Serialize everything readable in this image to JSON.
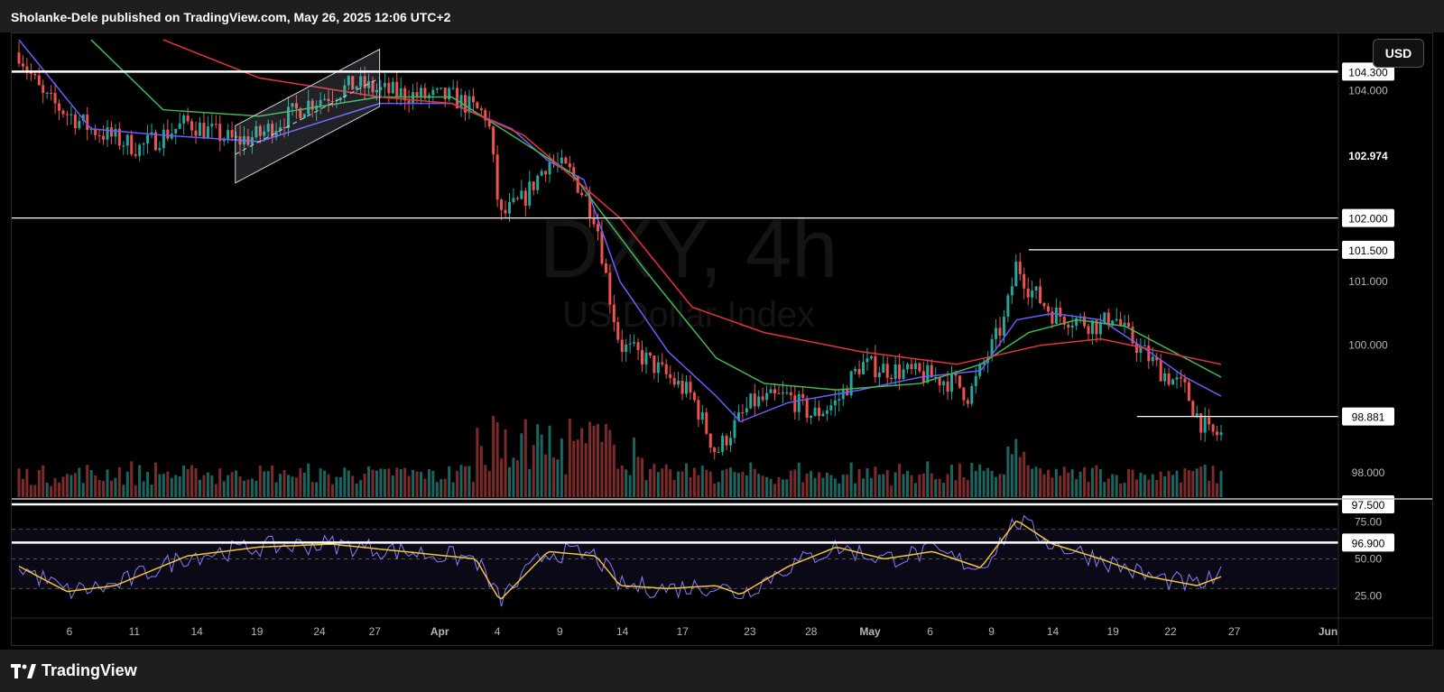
{
  "header": {
    "publisher_line": "Sholanke-Dele published on TradingView.com, May 26, 2025 12:06 UTC+2"
  },
  "toolbar": {
    "currency_label": "USD"
  },
  "footer": {
    "brand": "TradingView"
  },
  "watermark": {
    "symbol": "DXY, 4h",
    "name": "US Dollar Index"
  },
  "colors": {
    "background": "#000000",
    "bull": "#26a69a",
    "bear": "#ef5350",
    "ma_fast": "#6a5cff",
    "ma_mid": "#3fb950",
    "ma_slow": "#e8333b",
    "rsi": "#8c7bff",
    "rsi_ma": "#f2c530"
  },
  "chart_data": {
    "type": "candlestick",
    "symbol": "DXY",
    "timeframe": "4h",
    "price_axis": {
      "ticks": [
        "104.000",
        "101.000",
        "100.000",
        "98.000"
      ],
      "ylim": [
        97.6,
        104.9
      ]
    },
    "x_axis": {
      "tick_labels": [
        "6",
        "11",
        "14",
        "19",
        "24",
        "27",
        "Apr",
        "4",
        "9",
        "14",
        "17",
        "23",
        "28",
        "May",
        "6",
        "9",
        "14",
        "19",
        "22",
        "27",
        "Jun"
      ]
    },
    "horizontal_levels": [
      {
        "label": "104.300",
        "value": 104.3
      },
      {
        "label": "102.000",
        "value": 102.0
      },
      {
        "label": "101.500",
        "value": 101.5
      },
      {
        "label": "98.881",
        "value": 98.881
      },
      {
        "label": "97.500",
        "value": 97.5
      },
      {
        "label": "96.900",
        "value": 96.9
      }
    ],
    "current_price_label": "102.974",
    "price_path": [
      [
        0,
        104.6
      ],
      [
        2,
        103.9
      ],
      [
        6,
        103.4
      ],
      [
        10,
        103.1
      ],
      [
        14,
        103.5
      ],
      [
        18,
        103.2
      ],
      [
        20,
        103.3
      ],
      [
        24,
        103.8
      ],
      [
        28,
        104.1
      ],
      [
        30,
        104.0
      ],
      [
        34,
        103.9
      ],
      [
        36,
        103.9
      ],
      [
        39,
        103.6
      ],
      [
        40,
        102.0
      ],
      [
        42,
        102.3
      ],
      [
        44,
        102.9
      ],
      [
        46,
        102.7
      ],
      [
        48,
        102.0
      ],
      [
        49,
        100.9
      ],
      [
        50,
        100.0
      ],
      [
        52,
        99.8
      ],
      [
        54,
        99.5
      ],
      [
        56,
        99.2
      ],
      [
        58,
        98.3
      ],
      [
        59,
        98.6
      ],
      [
        61,
        99.1
      ],
      [
        64,
        99.2
      ],
      [
        66,
        98.9
      ],
      [
        68,
        99.1
      ],
      [
        70,
        99.7
      ],
      [
        73,
        99.6
      ],
      [
        76,
        99.5
      ],
      [
        78,
        99.4
      ],
      [
        79,
        99.2
      ],
      [
        81,
        100.0
      ],
      [
        82,
        100.4
      ],
      [
        83,
        101.3
      ],
      [
        84,
        100.9
      ],
      [
        86,
        100.5
      ],
      [
        88,
        100.4
      ],
      [
        90,
        100.3
      ],
      [
        91,
        100.5
      ],
      [
        92,
        100.2
      ],
      [
        94,
        99.8
      ],
      [
        95,
        99.6
      ],
      [
        97,
        99.3
      ],
      [
        98,
        98.9
      ],
      [
        99,
        98.6
      ],
      [
        100,
        98.6
      ]
    ],
    "moving_averages": [
      {
        "color": "#6a5cff",
        "path": [
          [
            0,
            104.8
          ],
          [
            6,
            103.4
          ],
          [
            12,
            103.3
          ],
          [
            20,
            103.2
          ],
          [
            30,
            103.8
          ],
          [
            36,
            103.8
          ],
          [
            41,
            103.4
          ],
          [
            44,
            102.9
          ],
          [
            47,
            102.6
          ],
          [
            50,
            101.0
          ],
          [
            54,
            99.9
          ],
          [
            58,
            99.2
          ],
          [
            60,
            98.8
          ],
          [
            64,
            99.1
          ],
          [
            70,
            99.3
          ],
          [
            75,
            99.5
          ],
          [
            80,
            99.6
          ],
          [
            83,
            100.4
          ],
          [
            86,
            100.5
          ],
          [
            90,
            100.4
          ],
          [
            94,
            99.9
          ],
          [
            97,
            99.5
          ],
          [
            100,
            99.2
          ]
        ]
      },
      {
        "color": "#3fb950",
        "path": [
          [
            6,
            104.8
          ],
          [
            12,
            103.7
          ],
          [
            20,
            103.6
          ],
          [
            30,
            103.9
          ],
          [
            36,
            103.9
          ],
          [
            41,
            103.3
          ],
          [
            46,
            102.7
          ],
          [
            52,
            101.2
          ],
          [
            58,
            99.8
          ],
          [
            62,
            99.4
          ],
          [
            68,
            99.3
          ],
          [
            75,
            99.4
          ],
          [
            80,
            99.7
          ],
          [
            84,
            100.2
          ],
          [
            88,
            100.4
          ],
          [
            92,
            100.3
          ],
          [
            96,
            99.9
          ],
          [
            100,
            99.5
          ]
        ]
      },
      {
        "color": "#e8333b",
        "path": [
          [
            12,
            104.8
          ],
          [
            20,
            104.2
          ],
          [
            30,
            103.9
          ],
          [
            36,
            103.8
          ],
          [
            42,
            103.3
          ],
          [
            50,
            102.0
          ],
          [
            56,
            100.6
          ],
          [
            62,
            100.2
          ],
          [
            70,
            99.9
          ],
          [
            78,
            99.7
          ],
          [
            85,
            100.0
          ],
          [
            90,
            100.1
          ],
          [
            95,
            99.9
          ],
          [
            100,
            99.7
          ]
        ]
      }
    ],
    "channel": {
      "from": [
        18,
        103.0
      ],
      "to": [
        30,
        104.2
      ],
      "width": 0.45
    },
    "rsi": {
      "axis_ticks": [
        "75.00",
        "50.00",
        "25.00"
      ],
      "levels": [
        70,
        50,
        30
      ],
      "ylim": [
        15,
        85
      ]
    }
  }
}
